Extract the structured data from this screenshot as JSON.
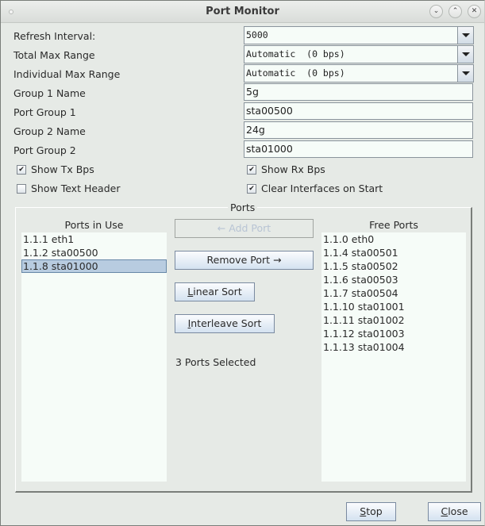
{
  "window": {
    "title": "Port Monitor",
    "controls": [
      "minimize",
      "maximize",
      "close"
    ]
  },
  "form": {
    "refresh_interval": {
      "label": "Refresh Interval:",
      "value": "5000"
    },
    "total_max_range": {
      "label": "Total Max Range",
      "value": "Automatic  (0 bps)"
    },
    "individual_max_range": {
      "label": "Individual Max Range",
      "value": "Automatic  (0 bps)"
    },
    "group1_name": {
      "label": "Group 1 Name",
      "value": "5g"
    },
    "port_group1": {
      "label": "Port Group 1",
      "value": "sta00500"
    },
    "group2_name": {
      "label": "Group 2 Name",
      "value": "24g"
    },
    "port_group2": {
      "label": "Port Group 2",
      "value": "sta01000"
    }
  },
  "checkboxes": {
    "show_tx_bps": {
      "label": "Show Tx Bps",
      "checked": true
    },
    "show_rx_bps": {
      "label": "Show Rx Bps",
      "checked": true
    },
    "show_text_header": {
      "label": "Show Text Header",
      "checked": false
    },
    "clear_interfaces": {
      "label": "Clear Interfaces on Start",
      "checked": true
    }
  },
  "ports": {
    "group_title": "Ports",
    "in_use": {
      "header": "Ports in Use",
      "items": [
        "1.1.1 eth1",
        "1.1.2 sta00500",
        "1.1.8 sta01000"
      ],
      "selected_index": 2
    },
    "free": {
      "header": "Free Ports",
      "items": [
        "1.1.0 eth0",
        "1.1.4 sta00501",
        "1.1.5 sta00502",
        "1.1.6 sta00503",
        "1.1.7 sta00504",
        "1.1.10 sta01001",
        "1.1.11 sta01002",
        "1.1.12 sta01003",
        "1.1.13 sta01004"
      ]
    },
    "buttons": {
      "add_port": "← Add Port",
      "remove_port": "Remove Port →",
      "linear_sort_mnemonic": "L",
      "linear_sort_rest": "inear Sort",
      "interleave_sort_mnemonic": "I",
      "interleave_sort_rest": "nterleave Sort"
    },
    "status": "3 Ports Selected"
  },
  "footer": {
    "stop_mnemonic": "S",
    "stop_rest": "top",
    "close_mnemonic": "C",
    "close_rest": "lose"
  },
  "icons": {
    "minimize": "⌄",
    "maximize": "⌃",
    "close": "✕",
    "check": "✔"
  }
}
